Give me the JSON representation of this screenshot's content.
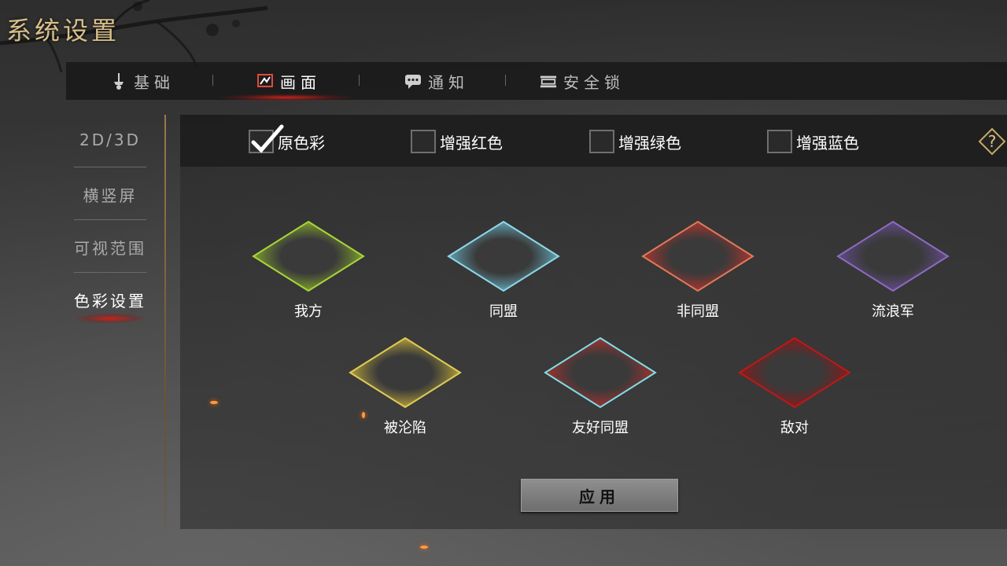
{
  "title": "系统设置",
  "tabs": [
    {
      "label": "基础",
      "icon": "sword-icon"
    },
    {
      "label": "画面",
      "icon": "display-icon"
    },
    {
      "label": "通知",
      "icon": "chat-bubble-icon"
    },
    {
      "label": "安全锁",
      "icon": "lock-box-icon"
    }
  ],
  "active_tab": "画面",
  "side_nav": [
    {
      "label": "2D/3D"
    },
    {
      "label": "横竖屏"
    },
    {
      "label": "可视范围"
    },
    {
      "label": "色彩设置"
    }
  ],
  "active_side": "色彩设置",
  "color_options": [
    {
      "label": "原色彩",
      "checked": true
    },
    {
      "label": "增强红色",
      "checked": false
    },
    {
      "label": "增强绿色",
      "checked": false
    },
    {
      "label": "增强蓝色",
      "checked": false
    }
  ],
  "help_icon": "question-mark-icon",
  "factions": [
    {
      "label": "我方",
      "color": "#8cb52a",
      "edge": "#a9d63a"
    },
    {
      "label": "同盟",
      "color": "#6ab8cc",
      "edge": "#8fd8ea"
    },
    {
      "label": "非同盟",
      "color": "#c0352e",
      "edge": "#e07a5a"
    },
    {
      "label": "流浪军",
      "color": "#6a4f9a",
      "edge": "#8c6cc0"
    },
    {
      "label": "被沦陷",
      "color": "#c9b43a",
      "edge": "#e0cc55"
    },
    {
      "label": "友好同盟",
      "color": "#b8302c",
      "edge": "#7fe0e8"
    },
    {
      "label": "敌对",
      "color": "#9a1414",
      "edge": "#c01818"
    }
  ],
  "apply_label": "应用"
}
